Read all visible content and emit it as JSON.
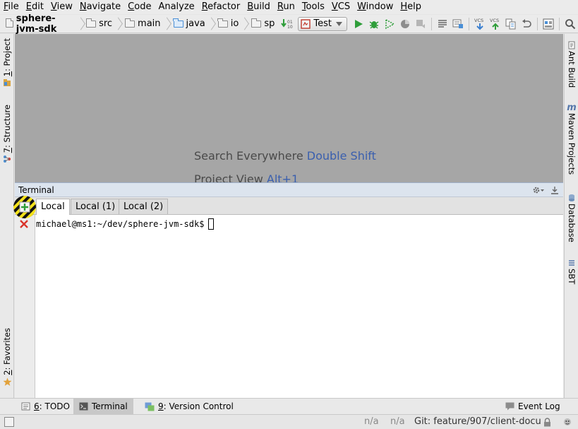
{
  "menu": [
    {
      "mnemonic": "F",
      "rest": "ile"
    },
    {
      "mnemonic": "E",
      "rest": "dit"
    },
    {
      "mnemonic": "V",
      "rest": "iew"
    },
    {
      "mnemonic": "N",
      "rest": "avigate"
    },
    {
      "mnemonic": "C",
      "rest": "ode"
    },
    {
      "mnemonic": "",
      "rest": "Analyze"
    },
    {
      "mnemonic": "R",
      "rest": "efactor"
    },
    {
      "mnemonic": "B",
      "rest": "uild"
    },
    {
      "mnemonic": "R",
      "rest": "un"
    },
    {
      "mnemonic": "T",
      "rest": "ools"
    },
    {
      "mnemonic": "V",
      "rest": "CS"
    },
    {
      "mnemonic": "W",
      "rest": "indow"
    },
    {
      "mnemonic": "H",
      "rest": "elp"
    }
  ],
  "breadcrumbs": [
    "sphere-jvm-sdk",
    "src",
    "main",
    "java",
    "io",
    "sp"
  ],
  "run_config": {
    "label": "Test"
  },
  "toolbar": {
    "vcs_label": "VCS"
  },
  "left_tools": {
    "project": {
      "num": "1",
      "label": ": Project"
    },
    "structure": {
      "num": "7",
      "label": ": Structure"
    },
    "favorites": {
      "num": "2",
      "label": ": Favorites"
    }
  },
  "right_tools": {
    "ant": "Ant Build",
    "maven": "Maven Projects",
    "database": "Database",
    "sbt": "SBT"
  },
  "editor_hints": [
    {
      "text": "Search Everywhere ",
      "key": "Double Shift"
    },
    {
      "text": "Project View ",
      "key": "Alt+1"
    }
  ],
  "terminal": {
    "title": "Terminal",
    "tabs": [
      "Local",
      "Local (1)",
      "Local (2)"
    ],
    "prompt": "michael@ms1:~/dev/sphere-jvm-sdk$"
  },
  "bottom_tabs": {
    "todo": {
      "num": "6",
      "label": ": TODO"
    },
    "terminal": {
      "label": "Terminal"
    },
    "vcs": {
      "num": "9",
      "label": ": Version Control"
    },
    "event_log": {
      "label": "Event Log"
    }
  },
  "status": {
    "pos1": "n/a",
    "pos2": "n/a",
    "git": "Git: feature/907/client-docu"
  },
  "colors": {
    "accent_blue": "#3a5fae",
    "run_green": "#2f9e3a",
    "stop_red": "#d9342b",
    "editor_bg": "#a6a6a6"
  }
}
